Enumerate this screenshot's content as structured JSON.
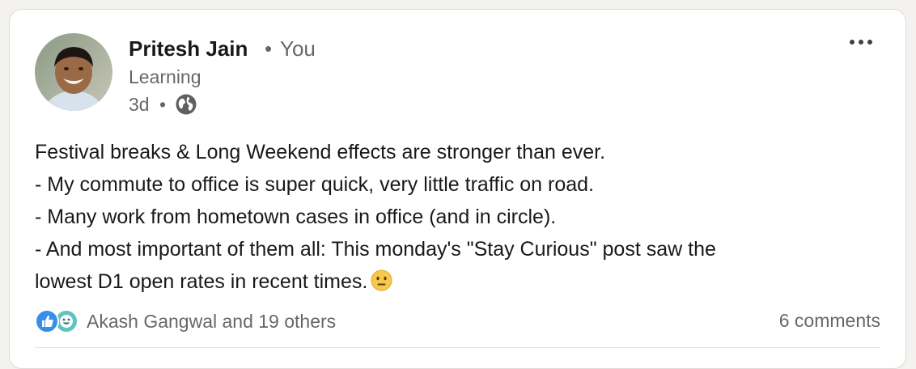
{
  "post": {
    "author": {
      "name": "Pritesh Jain",
      "separator": "•",
      "relation": "You",
      "headline": "Learning",
      "time": "3d",
      "time_separator": "•",
      "visibility_icon": "globe-icon",
      "avatar_icon": "avatar-photo"
    },
    "menu_icon": "more-options-icon",
    "body_lines": [
      "Festival breaks & Long Weekend effects are stronger than ever.",
      "- My commute to office is super quick, very little traffic on road.",
      "- Many work from hometown cases in office (and in circle).",
      "- And most important of them all: This monday's \"Stay Curious\" post saw the",
      "lowest D1 open rates in recent times."
    ],
    "body_emoji": "neutral-face-emoji",
    "social": {
      "reaction_icons": [
        "like-icon",
        "insightful-icon"
      ],
      "reactions_text": "Akash Gangwal and 19 others",
      "comments_text": "6 comments"
    }
  },
  "colors": {
    "page_bg": "#f4f2ee",
    "card_bg": "#ffffff",
    "like_blue": "#378fe9",
    "insightful_teal": "#5ec4c0"
  }
}
